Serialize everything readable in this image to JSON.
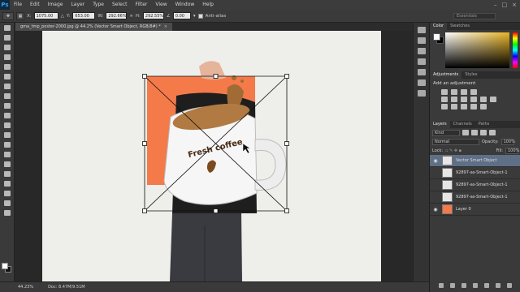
{
  "menubar": {
    "logo": "Ps",
    "items": [
      "File",
      "Edit",
      "Image",
      "Layer",
      "Type",
      "Select",
      "Filter",
      "View",
      "Window",
      "Help"
    ],
    "window_controls": [
      "–",
      "□",
      "×"
    ]
  },
  "options": {
    "x_label": "X:",
    "x_value": "1075.00 px",
    "y_label": "Y:",
    "y_value": "653.00 px",
    "w_label": "W:",
    "w_value": "292.66%",
    "h_label": "H:",
    "h_value": "292.55%",
    "angle_value": "0.00",
    "antialias_label": "Anti-alias",
    "workspace": "Essentials"
  },
  "document": {
    "tab_title": "gma_tmp_poster-2000.jpg @ 44.2% (Vector Smart Object, RGB/8#) *",
    "tab_close": "×",
    "mug_text": "Fresh coffee"
  },
  "status": {
    "zoom": "44.23%",
    "doc_info": "Doc: 8.47M/9.51M"
  },
  "panels": {
    "color_tabs": [
      "Color",
      "Swatches"
    ],
    "adjust_tabs": [
      "Adjustments",
      "Styles"
    ],
    "adjust_title": "Add an adjustment",
    "layers_tabs": [
      "Layers",
      "Channels",
      "Paths"
    ],
    "kind_label": "Kind",
    "blend_mode": "Normal",
    "opacity_label": "Opacity:",
    "opacity_value": "100%",
    "lock_label": "Lock:",
    "fill_label": "Fill:",
    "fill_value": "100%",
    "layers": [
      {
        "name": "Vector Smart Object",
        "selected": true,
        "visible": true
      },
      {
        "name": "92897-as-Smart-Object-1",
        "selected": false,
        "visible": false
      },
      {
        "name": "92897-as-Smart-Object-1",
        "selected": false,
        "visible": false
      },
      {
        "name": "92897-as-Smart-Object-1",
        "selected": false,
        "visible": false
      },
      {
        "name": "Layer 0",
        "selected": false,
        "visible": true
      }
    ]
  },
  "colors": {
    "orange_rect": "#f47a4a",
    "canvas_bg": "#eeeeea",
    "coffee": "#9a6a38",
    "mug_text": "#4a2a12"
  }
}
